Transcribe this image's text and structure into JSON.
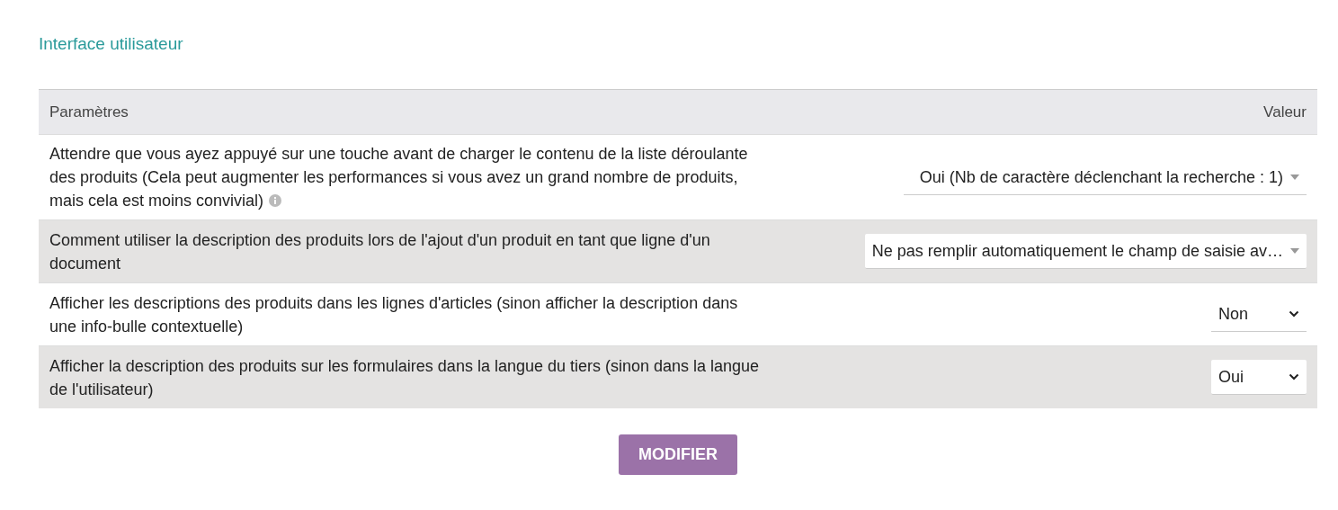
{
  "section_title": "Interface utilisateur",
  "table": {
    "columns": [
      "Paramètres",
      "Valeur"
    ],
    "rows": [
      {
        "label": "Attendre que vous ayez appuyé sur une touche avant de charger le contenu de la liste déroulante des produits (Cela peut augmenter les performances si vous avez un grand nombre de produits, mais cela est moins convivial)",
        "info": true,
        "kind": "combo",
        "value": "Oui (Nb de caractère déclenchant la recherche : 1)"
      },
      {
        "label": "Comment utiliser la description des produits lors de l'ajout d'un produit en tant que ligne d'un document",
        "info": false,
        "kind": "combo",
        "value": "Ne pas remplir automatiquement le champ de saisie av…"
      },
      {
        "label": "Afficher les descriptions des produits dans les lignes d'articles (sinon afficher la description dans une info-bulle contextuelle)",
        "info": false,
        "kind": "native",
        "value": "Non"
      },
      {
        "label": "Afficher la description des produits sur les formulaires dans la langue du tiers (sinon dans la langue de l'utilisateur)",
        "info": false,
        "kind": "native",
        "value": "Oui"
      }
    ]
  },
  "button": "MODIFIER"
}
